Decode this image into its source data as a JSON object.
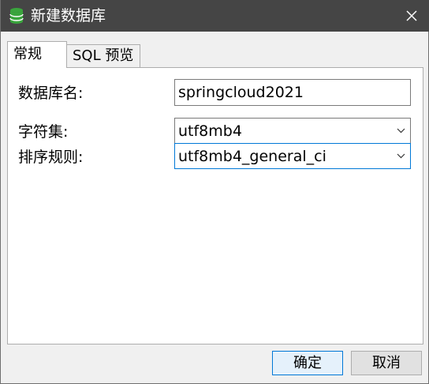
{
  "window": {
    "title": "新建数据库",
    "icon": "database-icon",
    "close_icon": "close-icon"
  },
  "tabs": [
    {
      "label": "常规",
      "active": true
    },
    {
      "label": "SQL 预览",
      "active": false
    }
  ],
  "form": {
    "db_name_label": "数据库名:",
    "db_name_value": "springcloud2021",
    "charset_label": "字符集:",
    "charset_value": "utf8mb4",
    "collation_label": "排序规则:",
    "collation_value": "utf8mb4_general_ci"
  },
  "buttons": {
    "ok": "确定",
    "cancel": "取消"
  },
  "colors": {
    "titlebar": "#454545",
    "icon_green": "#3aa53d",
    "focus_border": "#0078d7"
  }
}
